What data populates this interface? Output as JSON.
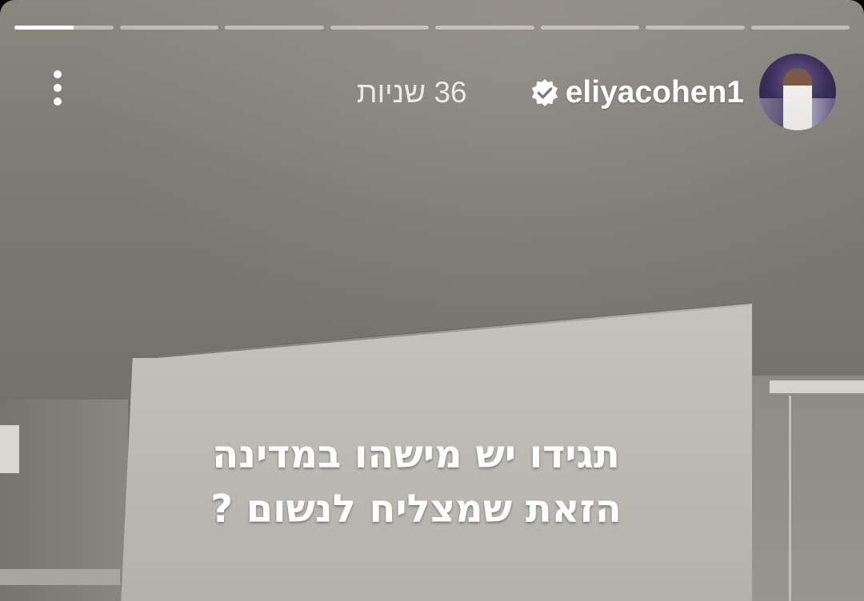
{
  "story": {
    "segment_count": 8,
    "active_segment_progress": 0.6,
    "username": "eliyacohen1",
    "verified": true,
    "time_ago": "36 שניות",
    "more_icon": "more-vertical-icon",
    "text_lines": [
      "תגידו יש מישהו במדינה",
      "הזאת שמצליח לנשום ?"
    ]
  },
  "colors": {
    "progress_active": "#ffffff",
    "progress_inactive": "rgba(255,255,255,0.45)",
    "text": "#ffffff"
  }
}
